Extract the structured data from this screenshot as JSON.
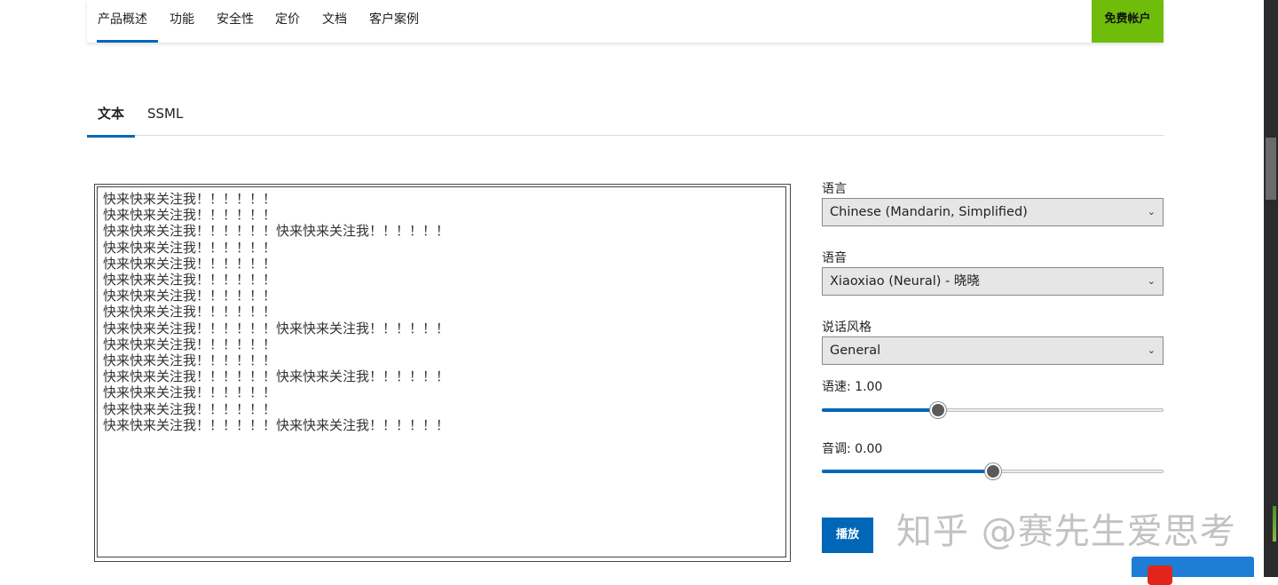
{
  "nav": {
    "items": [
      {
        "label": "产品概述",
        "active": true
      },
      {
        "label": "功能"
      },
      {
        "label": "安全性"
      },
      {
        "label": "定价"
      },
      {
        "label": "文档"
      },
      {
        "label": "客户案例"
      }
    ],
    "cta_label": "免费帐户"
  },
  "tabs": [
    {
      "label": "文本",
      "active": true
    },
    {
      "label": "SSML"
    }
  ],
  "editor": {
    "text": "快来快来关注我！！！！！！\n快来快来关注我！！！！！！\n快来快来关注我！！！！！！快来快来关注我！！！！！！\n快来快来关注我！！！！！！\n快来快来关注我！！！！！！\n快来快来关注我！！！！！！\n快来快来关注我！！！！！！\n快来快来关注我！！！！！！\n快来快来关注我！！！！！！快来快来关注我！！！！！！\n快来快来关注我！！！！！！\n快来快来关注我！！！！！！\n快来快来关注我！！！！！！快来快来关注我！！！！！！\n快来快来关注我！！！！！！\n快来快来关注我！！！！！！\n快来快来关注我！！！！！！快来快来关注我！！！！！！"
  },
  "panel": {
    "language_label": "语言",
    "language_value": "Chinese (Mandarin, Simplified)",
    "voice_label": "语音",
    "voice_value": "Xiaoxiao (Neural) - 晓晓",
    "style_label": "说话风格",
    "style_value": "General",
    "rate_label": "语速: 1.00",
    "rate_fraction": 0.34,
    "pitch_label": "音调: 0.00",
    "pitch_fraction": 0.5,
    "play_label": "播放"
  },
  "watermark": "知乎 @赛先生爱思考",
  "colors": {
    "accent": "#0067b8",
    "cta": "#6fbd0a"
  }
}
